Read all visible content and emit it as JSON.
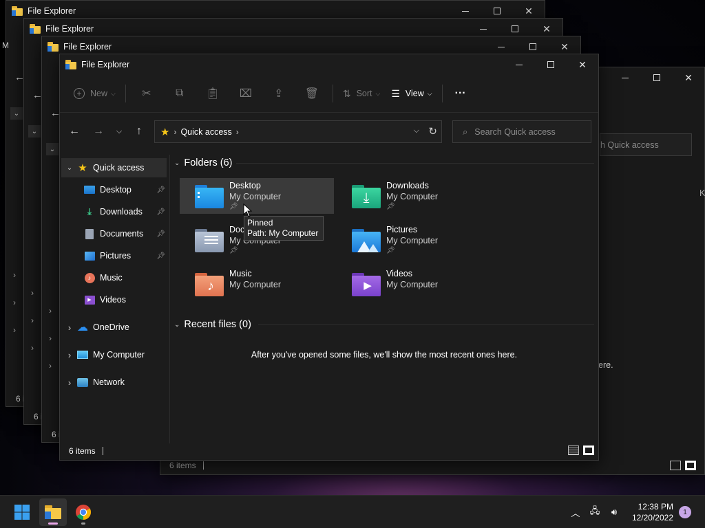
{
  "app_title": "File Explorer",
  "toolbar": {
    "new_label": "New",
    "sort_label": "Sort",
    "view_label": "View",
    "more_label": "···"
  },
  "address": {
    "crumb": "Quick access",
    "search_placeholder": "Search Quick access"
  },
  "nav": {
    "quick_access": "Quick access",
    "items": [
      {
        "label": "Desktop",
        "pinned": true,
        "icon": "desktop-icon"
      },
      {
        "label": "Downloads",
        "pinned": true,
        "icon": "downloads-icon"
      },
      {
        "label": "Documents",
        "pinned": true,
        "icon": "documents-icon"
      },
      {
        "label": "Pictures",
        "pinned": true,
        "icon": "pictures-icon"
      },
      {
        "label": "Music",
        "pinned": false,
        "icon": "music-icon"
      },
      {
        "label": "Videos",
        "pinned": false,
        "icon": "videos-icon"
      }
    ],
    "onedrive": "OneDrive",
    "my_computer": "My Computer",
    "network": "Network"
  },
  "content": {
    "folders_header": "Folders (6)",
    "folders": [
      {
        "name": "Desktop",
        "path": "My Computer",
        "pinned": true,
        "icon": "desktop-folder-icon"
      },
      {
        "name": "Downloads",
        "path": "My Computer",
        "pinned": true,
        "icon": "downloads-folder-icon"
      },
      {
        "name": "Documents",
        "name_visible": "Doc",
        "path": "My Computer",
        "pinned": true,
        "icon": "documents-folder-icon"
      },
      {
        "name": "Pictures",
        "path": "My Computer",
        "pinned": true,
        "icon": "pictures-folder-icon"
      },
      {
        "name": "Music",
        "path": "My Computer",
        "pinned": false,
        "icon": "music-folder-icon"
      },
      {
        "name": "Videos",
        "path": "My Computer",
        "pinned": false,
        "icon": "videos-folder-icon"
      }
    ],
    "recent_header": "Recent files (0)",
    "recent_empty": "After you've opened some files, we'll show the most recent ones here."
  },
  "tooltip": {
    "line1": "Pinned",
    "line2": "Path: My Computer"
  },
  "status": {
    "items_count": "6 items"
  },
  "background_windows": {
    "status_text": "6 items",
    "status_short": "6 i",
    "search_fragment": "h Quick access",
    "message_fragment": "ere.",
    "left_fragment": "M",
    "right_fragment": "K"
  },
  "taskbar": {
    "time": "12:38 PM",
    "date": "12/20/2022",
    "notification_count": "1"
  },
  "colors": {
    "accent": "#4cc2ff",
    "window_bg": "#1c1c1c",
    "star": "#f5c518"
  }
}
